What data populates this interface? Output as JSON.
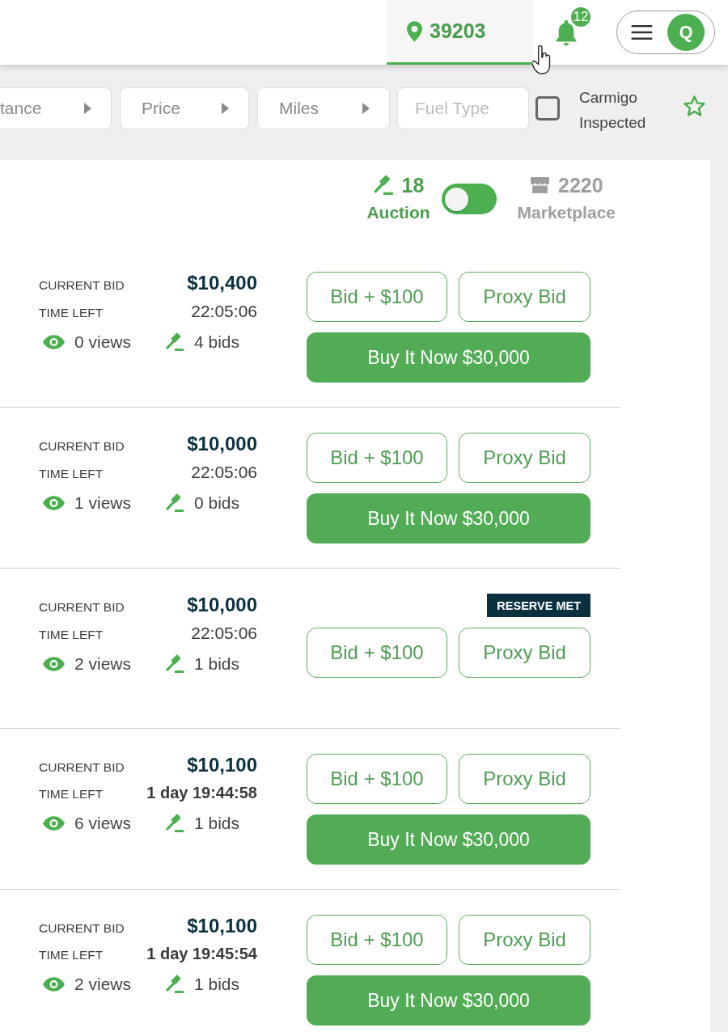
{
  "header": {
    "location": {
      "label": "39203",
      "selected": true
    },
    "notifications": {
      "count": "12"
    },
    "account_menu": {
      "avatar_initial": "Q"
    }
  },
  "filters": {
    "dropdowns": [
      {
        "label": "tance"
      },
      {
        "label": "Price"
      },
      {
        "label": "Miles"
      }
    ],
    "fuel_type": {
      "placeholder": "Fuel Type"
    },
    "inspected": {
      "label": "Carmigo Inspected",
      "checked": false
    }
  },
  "mode_switch": {
    "options": [
      {
        "kind": "auction",
        "count": "18",
        "label": "Auction",
        "selected": true
      },
      {
        "kind": "marketplace",
        "count": "2220",
        "label": "Marketplace",
        "selected": false
      }
    ]
  },
  "listings": [
    {
      "current_bid_label": "CURRENT BID",
      "current_bid": "$10,400",
      "time_left_label": "TIME LEFT",
      "time_left": "22:05:06",
      "time_left_bold": false,
      "views": "0 views",
      "bids": "4 bids",
      "actions": [
        {
          "kind": "outline",
          "label": "Bid + $100"
        },
        {
          "kind": "outline",
          "label": "Proxy Bid"
        },
        {
          "kind": "filled",
          "label": "Buy It Now $30,000"
        }
      ]
    },
    {
      "current_bid_label": "CURRENT BID",
      "current_bid": "$10,000",
      "time_left_label": "TIME LEFT",
      "time_left": "22:05:06",
      "time_left_bold": false,
      "views": "1 views",
      "bids": "0 bids",
      "actions": [
        {
          "kind": "outline",
          "label": "Bid + $100"
        },
        {
          "kind": "outline",
          "label": "Proxy Bid"
        },
        {
          "kind": "filled",
          "label": "Buy It Now $30,000"
        }
      ]
    },
    {
      "current_bid_label": "CURRENT BID",
      "current_bid": "$10,000",
      "time_left_label": "TIME LEFT",
      "time_left": "22:05:06",
      "time_left_bold": false,
      "views": "2 views",
      "bids": "1 bids",
      "badge": "RESERVE MET",
      "actions": [
        {
          "kind": "outline",
          "label": "Bid + $100"
        },
        {
          "kind": "outline",
          "label": "Proxy Bid"
        }
      ]
    },
    {
      "current_bid_label": "CURRENT BID",
      "current_bid": "$10,100",
      "time_left_label": "TIME LEFT",
      "time_left": "1 day 19:44:58",
      "time_left_bold": true,
      "views": "6 views",
      "bids": "1 bids",
      "actions": [
        {
          "kind": "outline",
          "label": "Bid + $100"
        },
        {
          "kind": "outline",
          "label": "Proxy Bid"
        },
        {
          "kind": "filled",
          "label": "Buy It Now $30,000"
        }
      ]
    },
    {
      "current_bid_label": "CURRENT BID",
      "current_bid": "$10,100",
      "time_left_label": "TIME LEFT",
      "time_left": "1 day 19:45:54",
      "time_left_bold": true,
      "views": "2 views",
      "bids": "1 bids",
      "actions": [
        {
          "kind": "outline",
          "label": "Bid + $100"
        },
        {
          "kind": "outline",
          "label": "Proxy Bid"
        },
        {
          "kind": "filled",
          "label": "Buy It Now $30,000"
        }
      ]
    }
  ]
}
